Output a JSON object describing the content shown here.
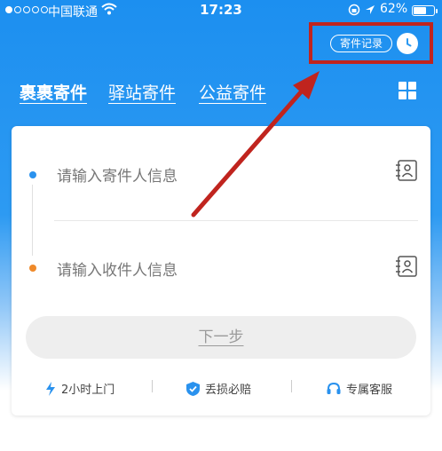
{
  "status_bar": {
    "carrier": "中国联通",
    "time": "17:23",
    "battery": "62%",
    "battery_level": 0.62
  },
  "header": {
    "record_label": "寄件记录"
  },
  "tabs": [
    {
      "label": "裹裹寄件"
    },
    {
      "label": "驿站寄件"
    },
    {
      "label": "公益寄件"
    }
  ],
  "form": {
    "sender_placeholder": "请输入寄件人信息",
    "receiver_placeholder": "请输入收件人信息",
    "next_label": "下一步"
  },
  "features": [
    {
      "label": "2小时上门",
      "icon": "lightning-icon"
    },
    {
      "label": "丢损必赔",
      "icon": "shield-check-icon"
    },
    {
      "label": "专属客服",
      "icon": "headset-icon"
    }
  ],
  "colors": {
    "brand_blue": "#1c8ff0",
    "highlight_red": "#c0241e",
    "sender_dot": "#2a92ee",
    "receiver_dot": "#ef8a2a"
  }
}
